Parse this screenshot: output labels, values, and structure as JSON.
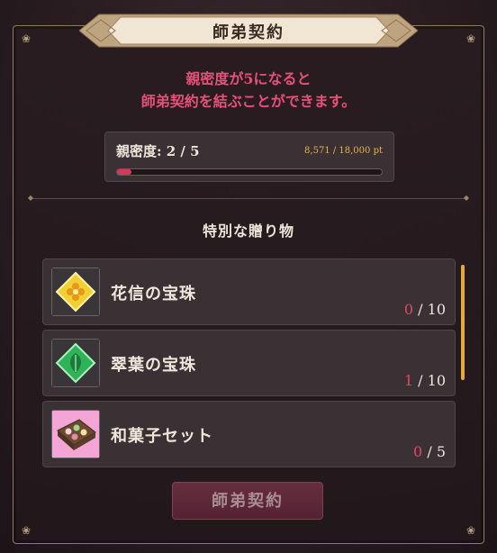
{
  "dialog": {
    "title": "師弟契約"
  },
  "notice": {
    "line1": "親密度が5になると",
    "line2": "師弟契約を結ぶことができます。"
  },
  "affinity": {
    "label": "親密度: 2 / 5",
    "points": "8,571 / 18,000 pt",
    "progress_fraction": 0.055
  },
  "gifts": {
    "section_title": "特別な贈り物",
    "items": [
      {
        "name": "花信の宝珠",
        "current": "0",
        "max": "10",
        "icon": "yellow-flower-gem-icon"
      },
      {
        "name": "翠葉の宝珠",
        "current": "1",
        "max": "10",
        "icon": "green-leaf-gem-icon"
      },
      {
        "name": "和菓子セット",
        "current": "0",
        "max": "5",
        "icon": "wagashi-box-icon"
      }
    ],
    "separator": "/"
  },
  "actions": {
    "contract_button": "師弟契約"
  },
  "colors": {
    "accent_pink": "#e8507a",
    "count_red": "#e04666",
    "points_gold": "#e6b24a",
    "scrollbar": "#e7a93a",
    "button": "#6e3142"
  }
}
